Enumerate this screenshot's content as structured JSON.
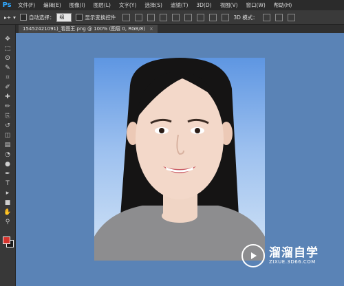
{
  "app": {
    "logo": "Ps"
  },
  "menu": [
    "文件(F)",
    "编辑(E)",
    "图像(I)",
    "图层(L)",
    "文字(Y)",
    "选择(S)",
    "滤镜(T)",
    "3D(D)",
    "视图(V)",
    "窗口(W)",
    "帮助(H)"
  ],
  "options": {
    "move_tool_glyph": "▸+",
    "auto_select_label": "自动选择：",
    "auto_select_value": "组",
    "show_transform_label": "显示变换控件",
    "mode_3d_label": "3D 模式："
  },
  "document_tab": {
    "title": "15452421091)_看图王.png @ 100% (图层 0, RGB/8)",
    "close_glyph": "×"
  },
  "tools": [
    "move",
    "marquee",
    "lasso",
    "quick-select",
    "crop",
    "eyedropper",
    "spot-heal",
    "brush",
    "clone-stamp",
    "history-brush",
    "eraser",
    "gradient",
    "blur",
    "dodge",
    "pen",
    "type",
    "path-select",
    "rectangle",
    "hand",
    "zoom"
  ],
  "tool_glyphs": [
    "✥",
    "⬚",
    "ʘ",
    "✎",
    "⌗",
    "✐",
    "✚",
    "✏",
    "⎘",
    "↺",
    "◫",
    "▤",
    "◔",
    "●",
    "✒",
    "T",
    "▸",
    "■",
    "✋",
    "⚲"
  ],
  "colors": {
    "foreground": "#d5332d",
    "background": "#1a1a1a",
    "canvas_bg": "#5a83b6"
  },
  "watermark": {
    "title": "溜溜自学",
    "subtitle": "ZIXUE.3D66.COM"
  }
}
